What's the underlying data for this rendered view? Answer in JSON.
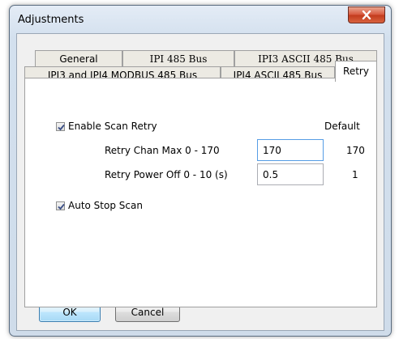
{
  "window": {
    "title": "Adjustments",
    "close_glyph": "close-icon"
  },
  "tabs": {
    "row1": [
      "General",
      "IPI 485 Bus",
      "IPI3 ASCII 485 Bus"
    ],
    "row2": [
      "IPI3 and IPI4 MODBUS 485 Bus",
      "IPI4 ASCII 485 Bus",
      "Retry"
    ],
    "active": "Retry"
  },
  "retry": {
    "enable_label": "Enable Scan Retry",
    "enable_checked": true,
    "default_header": "Default",
    "chan_max_label": "Retry Chan Max  0 - 170",
    "chan_max_value": "170",
    "chan_max_default": "170",
    "power_off_label": "Retry Power Off  0 - 10 (s)",
    "power_off_value": "0.5",
    "power_off_default": "1",
    "auto_stop_label": "Auto Stop Scan",
    "auto_stop_checked": true
  },
  "buttons": {
    "ok": "OK",
    "cancel": "Cancel"
  },
  "colors": {
    "title_bar": "#d3e0ee",
    "close_button": "#c23a1c",
    "default_button": "#bee6fd",
    "focus_border": "#569de5"
  }
}
